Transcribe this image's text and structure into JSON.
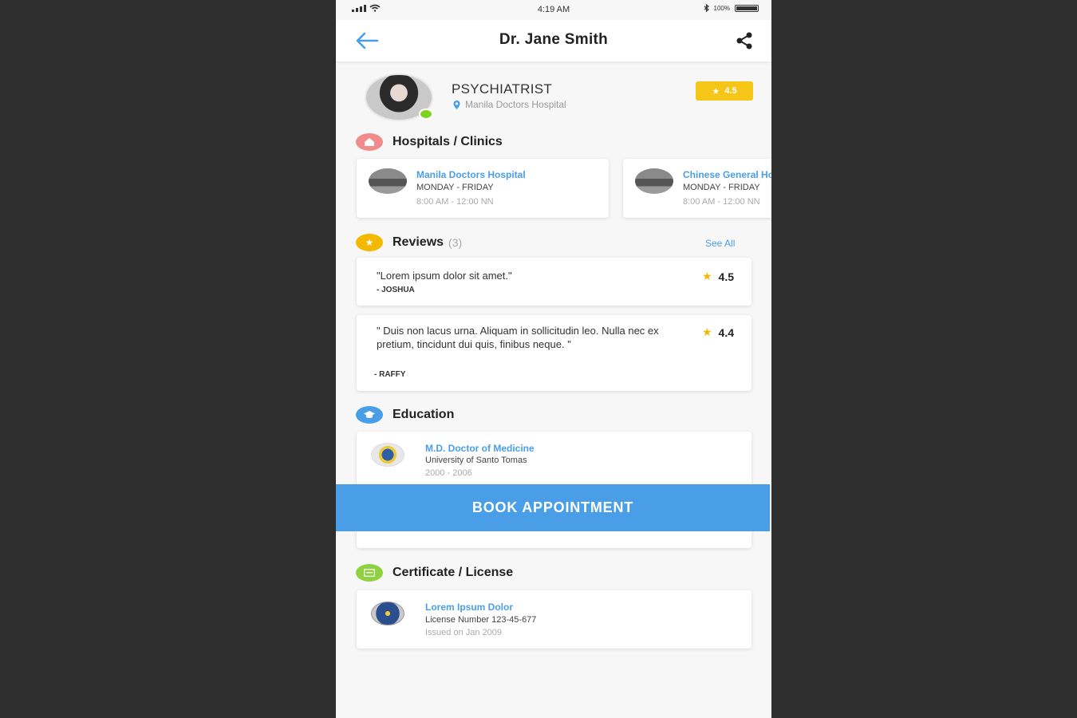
{
  "status_bar": {
    "time": "4:19 AM",
    "battery": "100%"
  },
  "header": {
    "title": "Dr. Jane Smith",
    "back_icon": "arrow-left-icon",
    "share_icon": "share-icon"
  },
  "profile": {
    "specialty": "PSYCHIATRIST",
    "location": "Manila Doctors Hospital",
    "rating": "4.5",
    "online_color": "#7ed321"
  },
  "hospitals": {
    "title": "Hospitals / Clinics",
    "items": [
      {
        "name": "Manila Doctors Hospital",
        "days": "MONDAY - FRIDAY",
        "hours": "8:00 AM - 12:00 NN"
      },
      {
        "name": "Chinese General Hospital",
        "days": "MONDAY - FRIDAY",
        "hours": "8:00 AM - 12:00 NN"
      }
    ]
  },
  "reviews": {
    "title": "Reviews",
    "count": "(3)",
    "see_all": "See All",
    "items": [
      {
        "text": "\"Lorem ipsum dolor sit amet.\"",
        "author": "- JOSHUA",
        "rating": "4.5"
      },
      {
        "text": "\" Duis non lacus urna. Aliquam in sollicitudin leo. Nulla nec ex pretium, tincidunt dui quis, finibus neque. \"",
        "author": "- RAFFY",
        "rating": "4.4"
      }
    ]
  },
  "education": {
    "title": "Education",
    "items": [
      {
        "degree": "M.D. Doctor of Medicine",
        "school": "University of Santo Tomas",
        "years": "2000 - 2006"
      }
    ]
  },
  "certificates": {
    "title": "Certificate / License",
    "items": [
      {
        "name": "Lorem Ipsum Dolor",
        "number": "License Number 123-45-677",
        "issued": "Issued on Jan 2009"
      }
    ]
  },
  "actions": {
    "book_label": "BOOK APPOINTMENT"
  },
  "colors": {
    "accent": "#4a9ee8",
    "rating": "#f5c518",
    "hospital_icon": "#f28b8b",
    "review_icon": "#f5b800",
    "education_icon": "#4a9ee8",
    "certificate_icon": "#8ed33f"
  }
}
